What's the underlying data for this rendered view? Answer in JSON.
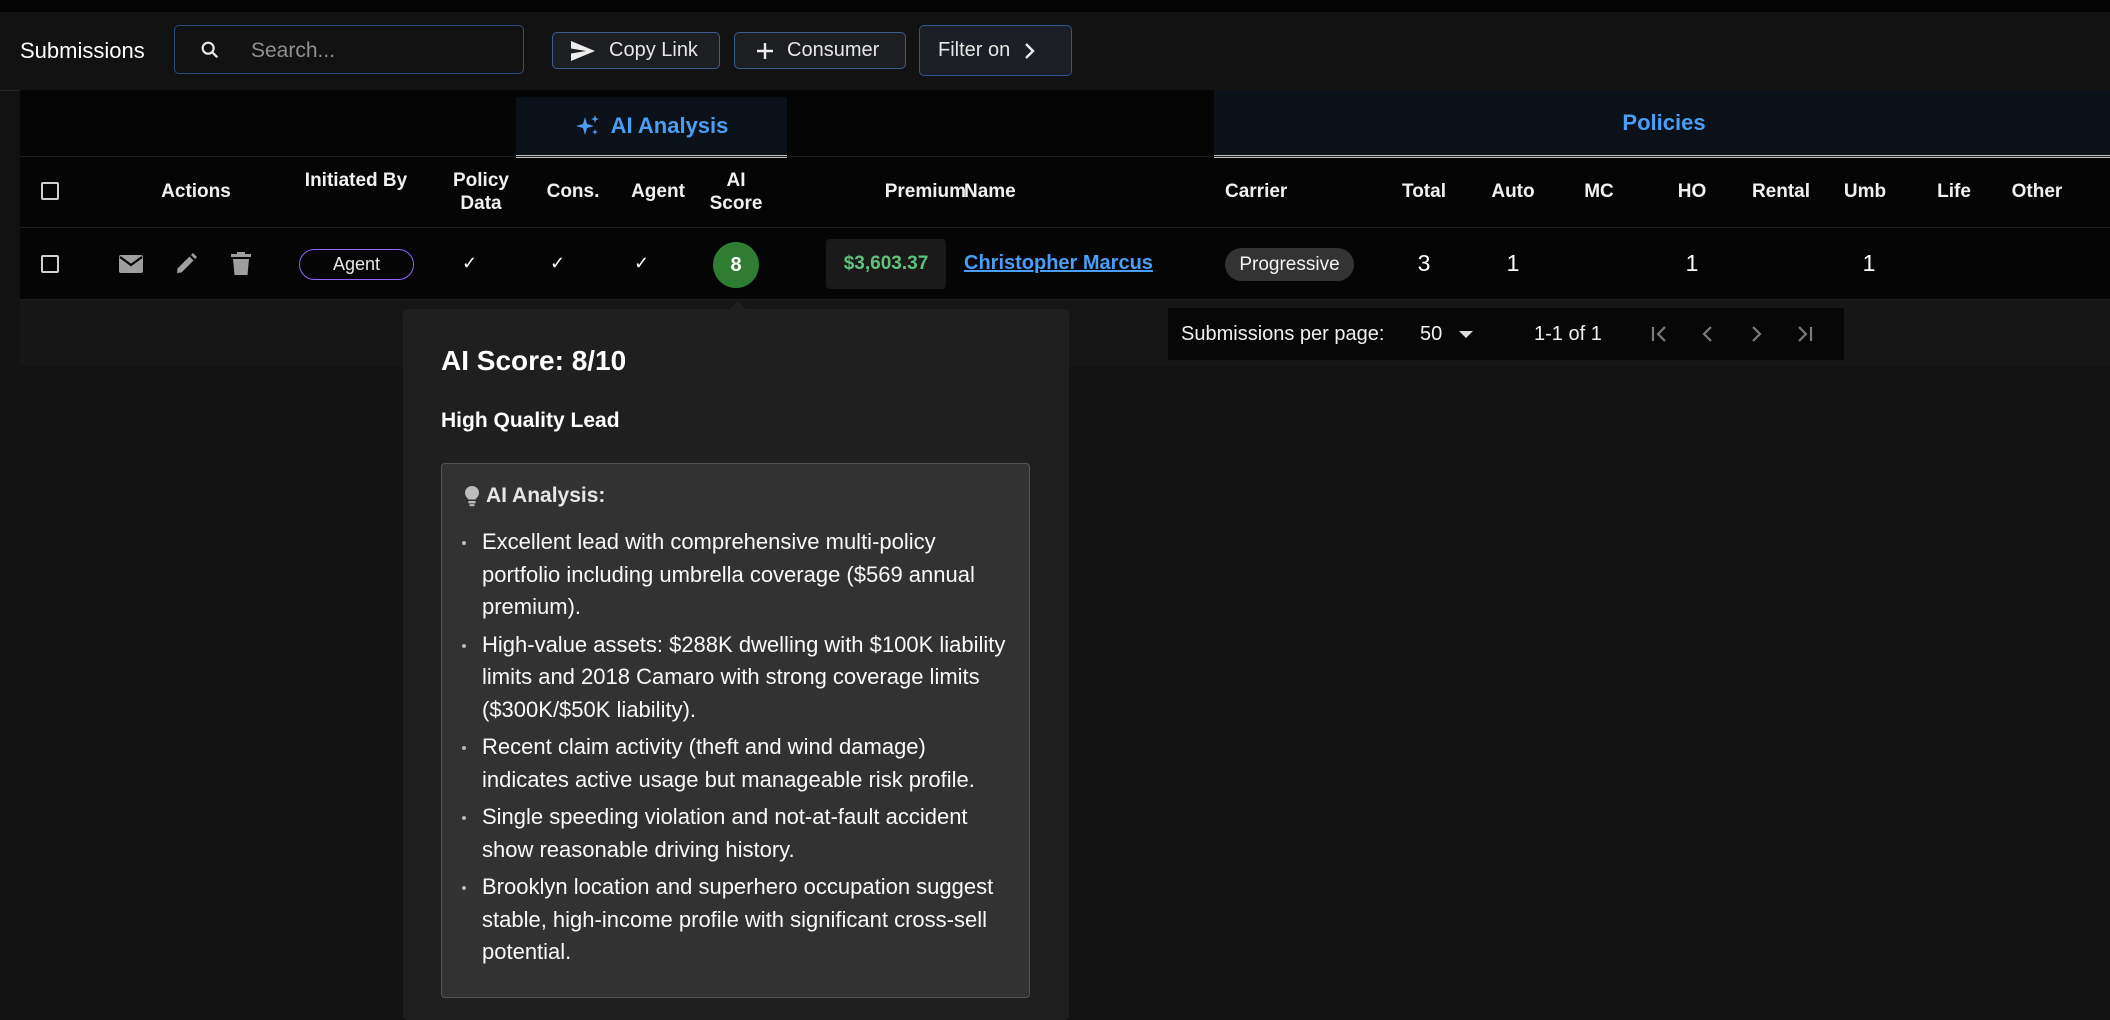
{
  "toolbar": {
    "title": "Submissions",
    "search_placeholder": "Search...",
    "copy_link_label": "Copy Link",
    "consumer_label": "Consumer",
    "filter_label": "Filter on"
  },
  "groups": {
    "ai_analysis": "AI Analysis",
    "policies": "Policies"
  },
  "columns": {
    "actions": "Actions",
    "initiated_by": "Initiated By",
    "policy_data": "Policy Data",
    "cons": "Cons.",
    "agent": "Agent",
    "ai_score": "AI Score",
    "premium": "Premium",
    "name": "Name",
    "carrier": "Carrier",
    "total": "Total",
    "auto": "Auto",
    "mc": "MC",
    "ho": "HO",
    "rental": "Rental",
    "umb": "Umb",
    "life": "Life",
    "other": "Other"
  },
  "row": {
    "initiated_by": "Agent",
    "policy_data": "✓",
    "cons": "✓",
    "agent": "✓",
    "ai_score": "8",
    "premium": "$3,603.37",
    "name": "Christopher Marcus",
    "carrier": "Progressive",
    "total": "3",
    "auto": "1",
    "mc": "",
    "ho": "1",
    "rental": "",
    "umb": "1",
    "life": "",
    "other": ""
  },
  "pagination": {
    "per_page_label": "Submissions per page:",
    "per_page_value": "50",
    "range": "1-1 of 1"
  },
  "popover": {
    "title": "AI Score: 8/10",
    "subtitle": "High Quality Lead",
    "analysis_heading": "AI Analysis:",
    "bullets": [
      "Excellent lead with comprehensive multi-policy portfolio including umbrella coverage ($569 annual premium).",
      "High-value assets: $288K dwelling with $100K liability limits and 2018 Camaro with strong coverage limits ($300K/$50K liability).",
      "Recent claim activity (theft and wind damage) indicates active usage but manageable risk profile.",
      "Single speeding violation and not-at-fault accident show reasonable driving history.",
      "Brooklyn location and superhero occupation suggest stable, high-income profile with significant cross-sell potential."
    ]
  },
  "colors": {
    "accent_blue": "#4a9ef5",
    "score_green": "#2e7d32",
    "premium_green": "#5fc27b",
    "chip_purple": "#8d65ff"
  },
  "icons": [
    "search-icon",
    "send-icon",
    "plus-icon",
    "chevron-right-icon",
    "sparkle-icon",
    "mail-icon",
    "pencil-icon",
    "trash-icon",
    "lightbulb-icon",
    "first-page-icon",
    "prev-page-icon",
    "next-page-icon",
    "last-page-icon"
  ]
}
